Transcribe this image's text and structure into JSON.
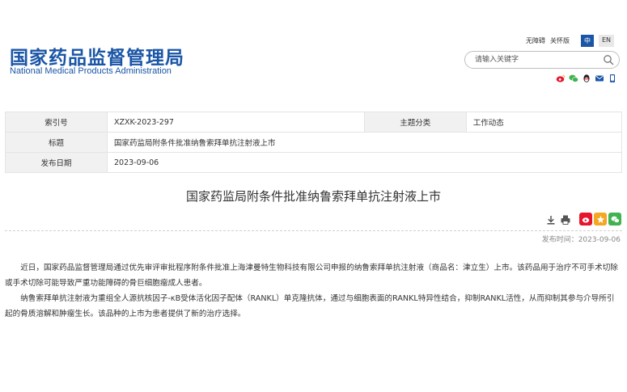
{
  "header": {
    "logo_cn": "国家药品监督管理局",
    "logo_en": "National Medical Products Administration",
    "accessibility": "无障碍",
    "care_edition": "关怀版",
    "lang_cn": "中",
    "lang_en": "EN",
    "search_placeholder": "请输入关键字"
  },
  "meta": {
    "index_label": "索引号",
    "index_value": "XZXK-2023-297",
    "category_label": "主题分类",
    "category_value": "工作动态",
    "title_label": "标题",
    "title_value": "国家药监局附条件批准纳鲁索拜单抗注射液上市",
    "date_label": "发布日期",
    "date_value": "2023-09-06"
  },
  "article": {
    "title": "国家药监局附条件批准纳鲁索拜单抗注射液上市",
    "publish_time": "发布时间：2023-09-06",
    "paragraphs": [
      "近日，国家药品监督管理局通过优先审评审批程序附条件批准上海津曼特生物科技有限公司申报的纳鲁索拜单抗注射液（商品名：津立生）上市。该药品用于治疗不可手术切除或手术切除可能导致严重功能障碍的骨巨细胞瘤成人患者。",
      "纳鲁索拜单抗注射液为重组全人源抗核因子-κB受体活化因子配体（RANKL）单克隆抗体，通过与细胞表面的RANKL特异性结合，抑制RANKL活性，从而抑制其参与介导所引起的骨质溶解和肿瘤生长。该品种的上市为患者提供了新的治疗选择。"
    ]
  },
  "colors": {
    "brand": "#1a55a6",
    "weibo": "#e6162d",
    "wechat": "#3fb34f",
    "star": "#f5a623"
  }
}
